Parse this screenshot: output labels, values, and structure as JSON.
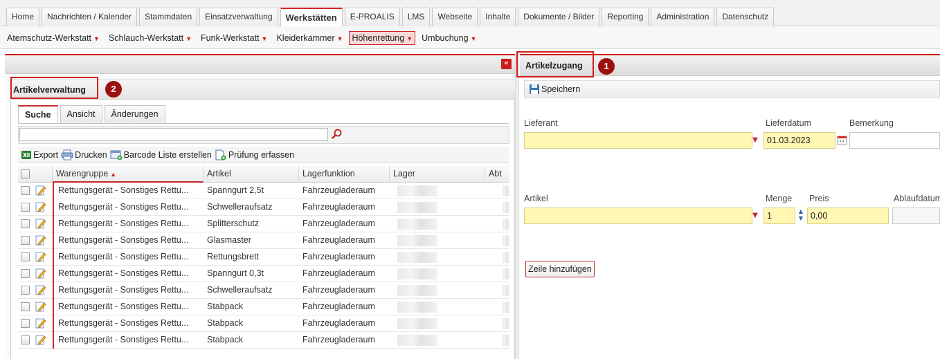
{
  "top_tabs": [
    {
      "label": "Home"
    },
    {
      "label": "Nachrichten / Kalender"
    },
    {
      "label": "Stammdaten"
    },
    {
      "label": "Einsatzverwaltung"
    },
    {
      "label": "Werkstätten",
      "active": true
    },
    {
      "label": "E-PROALIS"
    },
    {
      "label": "LMS"
    },
    {
      "label": "Webseite"
    },
    {
      "label": "Inhalte"
    },
    {
      "label": "Dokumente / Bilder"
    },
    {
      "label": "Reporting"
    },
    {
      "label": "Administration"
    },
    {
      "label": "Datenschutz"
    }
  ],
  "sub_menu": [
    {
      "label": "Atemschutz-Werkstatt"
    },
    {
      "label": "Schlauch-Werkstatt"
    },
    {
      "label": "Funk-Werkstatt"
    },
    {
      "label": "Kleiderkammer"
    },
    {
      "label": "Höhenrettung",
      "active": true
    },
    {
      "label": "Umbuchung"
    }
  ],
  "left_panel": {
    "collapse_icon": "double-chevron-left-icon",
    "title": "Artikelverwaltung",
    "badge": "2",
    "tabs": [
      {
        "label": "Suche",
        "active": true
      },
      {
        "label": "Ansicht"
      },
      {
        "label": "Änderungen"
      }
    ],
    "search": {
      "value": "",
      "placeholder": "",
      "icon": "magnifier-icon"
    },
    "toolbar": [
      {
        "label": "Export",
        "icon": "excel-export-icon"
      },
      {
        "label": "Drucken",
        "icon": "printer-icon"
      },
      {
        "label": "Barcode Liste erstellen",
        "icon": "barcode-list-icon"
      },
      {
        "label": "Prüfung erfassen",
        "icon": "inspection-icon"
      }
    ],
    "table": {
      "columns": [
        "Warengruppe",
        "Artikel",
        "Lagerfunktion",
        "Lager",
        "Abt"
      ],
      "sorted_column": "Warengruppe",
      "rows": [
        {
          "warengruppe": "Rettungsgerät - Sonstiges Rettu...",
          "artikel": "Spanngurt 2,5t",
          "lagerfunktion": "Fahrzeugladeraum"
        },
        {
          "warengruppe": "Rettungsgerät - Sonstiges Rettu...",
          "artikel": "Schwelleraufsatz",
          "lagerfunktion": "Fahrzeugladeraum"
        },
        {
          "warengruppe": "Rettungsgerät - Sonstiges Rettu...",
          "artikel": "Splitterschutz",
          "lagerfunktion": "Fahrzeugladeraum"
        },
        {
          "warengruppe": "Rettungsgerät - Sonstiges Rettu...",
          "artikel": "Glasmaster",
          "lagerfunktion": "Fahrzeugladeraum"
        },
        {
          "warengruppe": "Rettungsgerät - Sonstiges Rettu...",
          "artikel": "Rettungsbrett",
          "lagerfunktion": "Fahrzeugladeraum"
        },
        {
          "warengruppe": "Rettungsgerät - Sonstiges Rettu...",
          "artikel": "Spanngurt 0,3t",
          "lagerfunktion": "Fahrzeugladeraum"
        },
        {
          "warengruppe": "Rettungsgerät - Sonstiges Rettu...",
          "artikel": "Schwelleraufsatz",
          "lagerfunktion": "Fahrzeugladeraum"
        },
        {
          "warengruppe": "Rettungsgerät - Sonstiges Rettu...",
          "artikel": "Stabpack",
          "lagerfunktion": "Fahrzeugladeraum"
        },
        {
          "warengruppe": "Rettungsgerät - Sonstiges Rettu...",
          "artikel": "Stabpack",
          "lagerfunktion": "Fahrzeugladeraum"
        },
        {
          "warengruppe": "Rettungsgerät - Sonstiges Rettu...",
          "artikel": "Stabpack",
          "lagerfunktion": "Fahrzeugladeraum"
        }
      ]
    }
  },
  "right_panel": {
    "title": "Artikelzugang",
    "badge": "1",
    "save_label": "Speichern",
    "save_icon": "floppy-disk-icon",
    "lieferant_label": "Lieferant",
    "lieferant_value": "",
    "lieferdatum_label": "Lieferdatum",
    "lieferdatum_value": "01.03.2023",
    "bemerkung_label": "Bemerkung",
    "bemerkung_value": "",
    "artikel_label": "Artikel",
    "artikel_value": "",
    "menge_label": "Menge",
    "menge_value": "1",
    "preis_label": "Preis",
    "preis_value": "0,00",
    "ablaufdatum_label": "Ablaufdatum",
    "add_row_label": "Zeile hinzufügen"
  },
  "colors": {
    "accent_red": "#c62828",
    "badge": "#9e1010",
    "required_field": "#fff7b3"
  }
}
